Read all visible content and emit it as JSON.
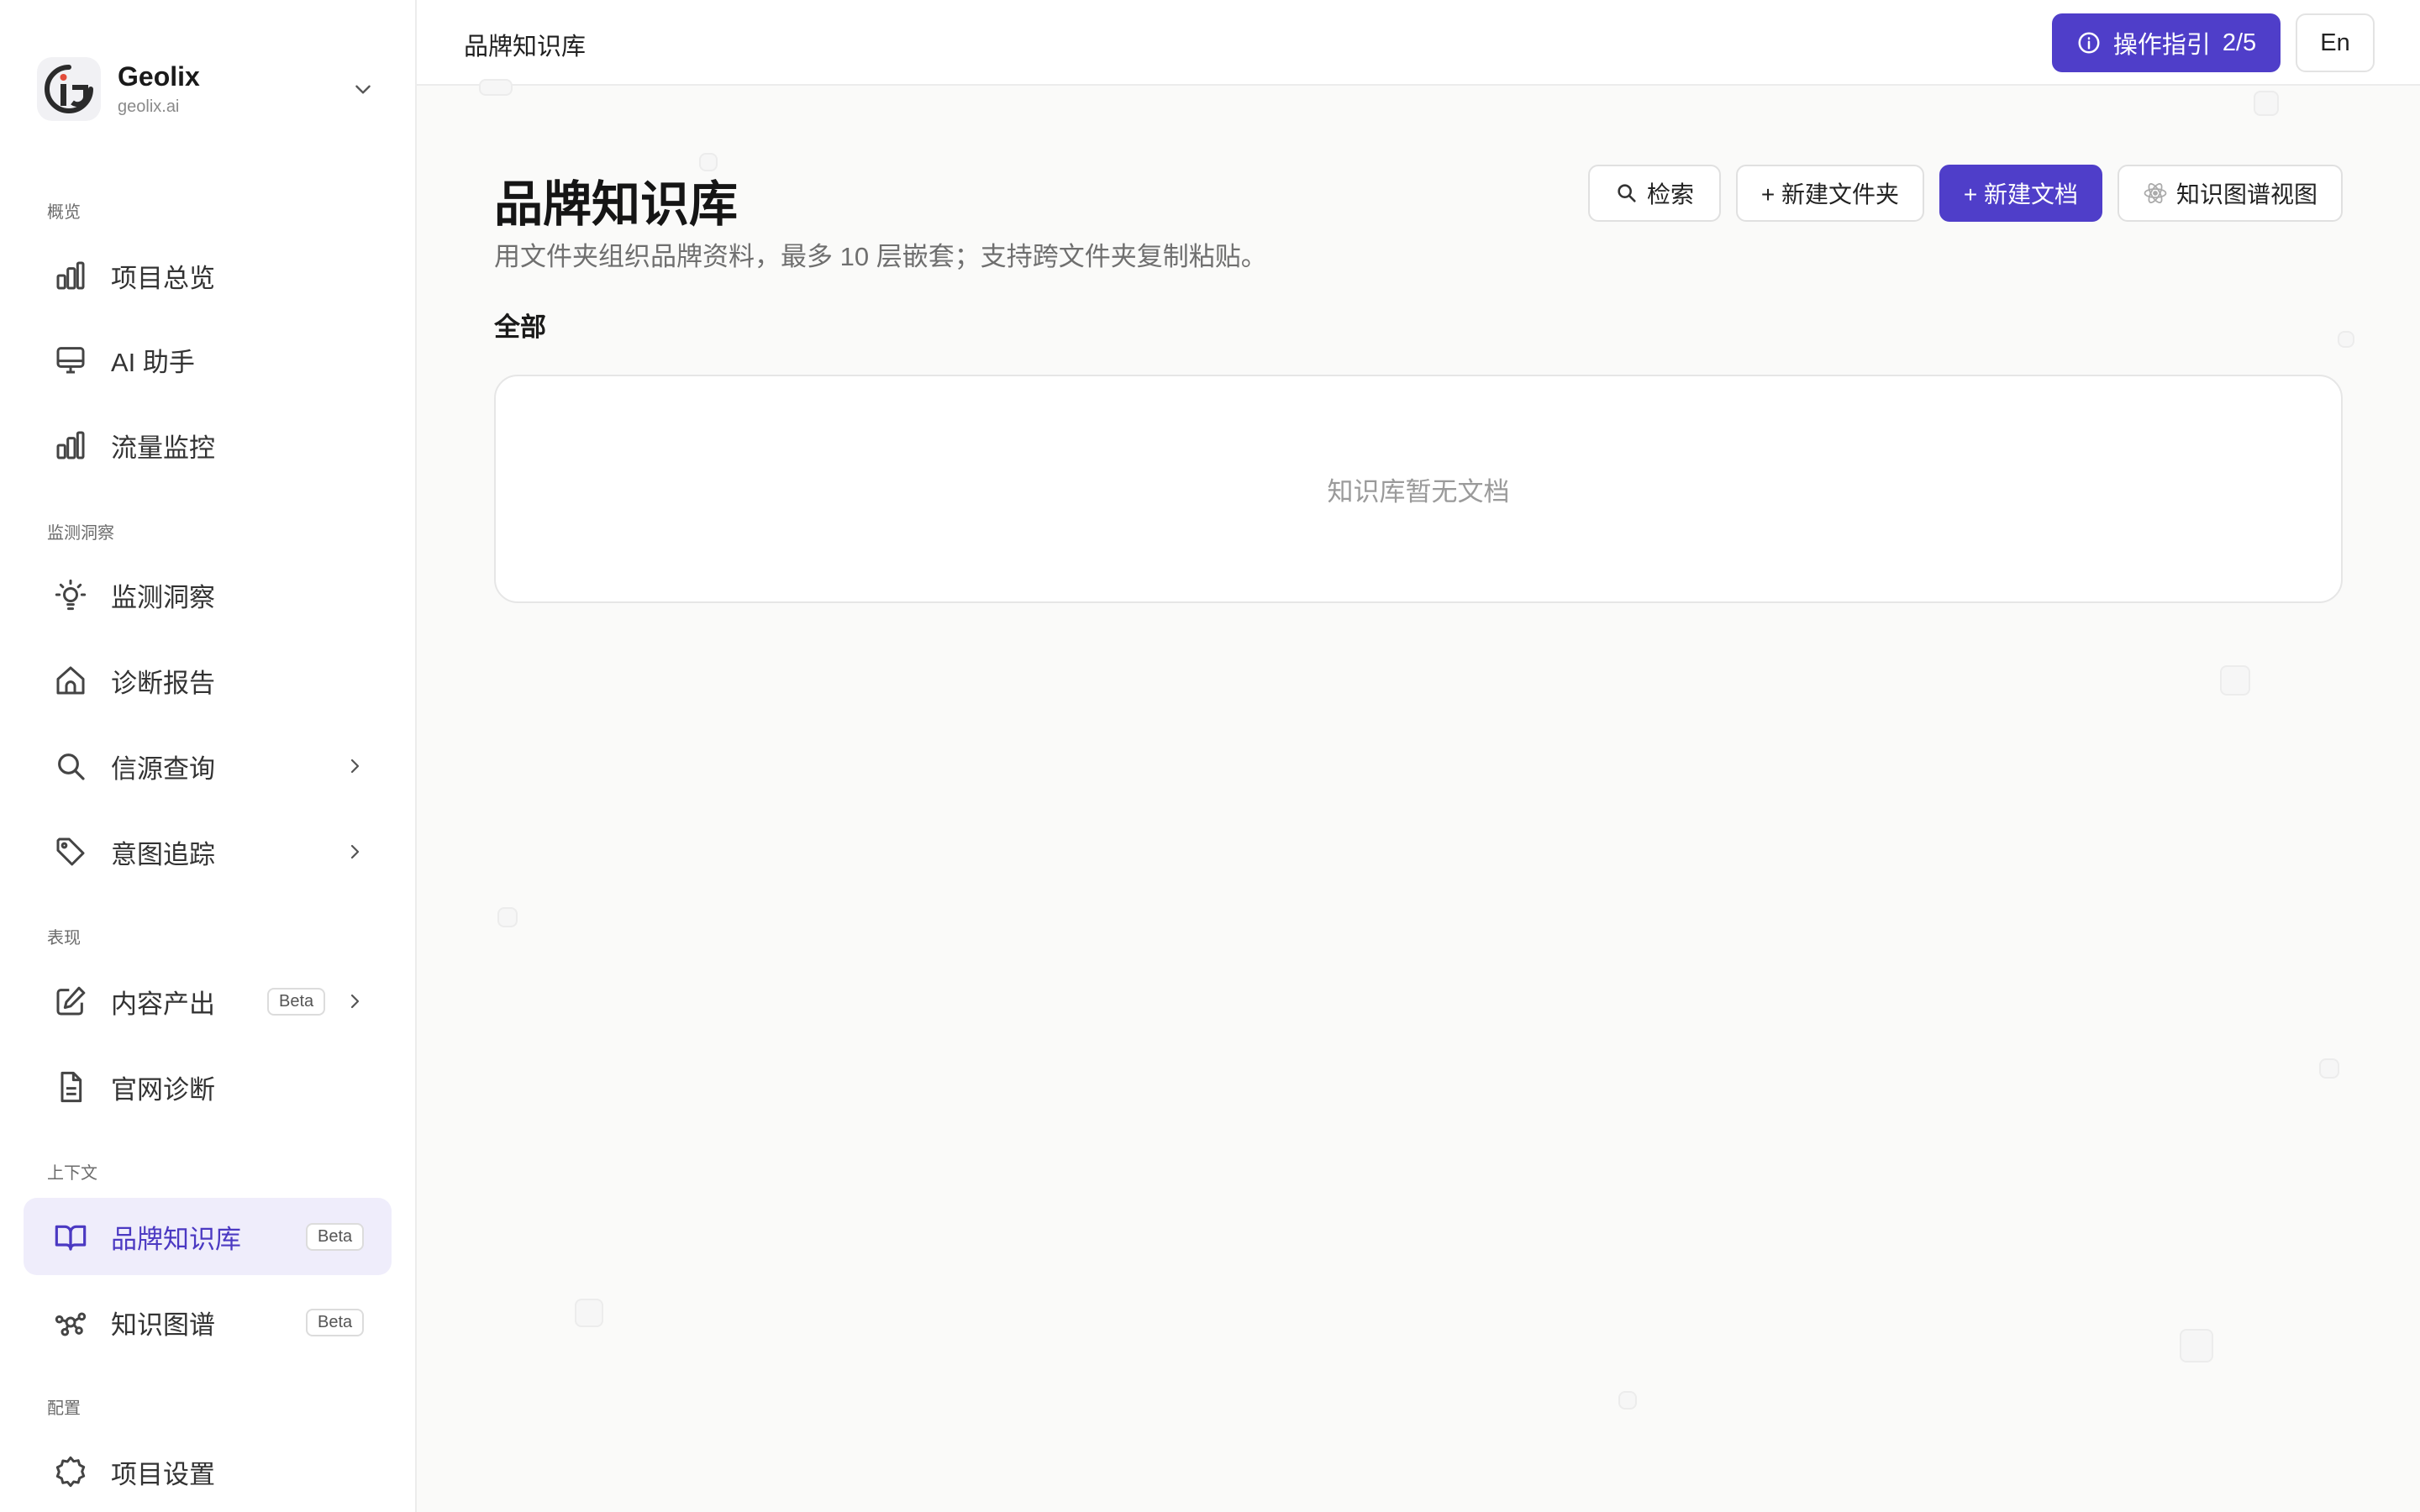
{
  "brand": {
    "name": "Geolix",
    "domain": "geolix.ai"
  },
  "sidebar": {
    "sections": {
      "overview": "概览",
      "monitor": "监测洞察",
      "performance": "表现",
      "context": "上下文",
      "config": "配置"
    },
    "items": [
      {
        "label": "项目总览",
        "icon": "bar-chart-icon"
      },
      {
        "label": "AI 助手",
        "icon": "monitor-icon"
      },
      {
        "label": "流量监控",
        "icon": "bar-chart-icon"
      },
      {
        "label": "监测洞察",
        "icon": "lightbulb-icon"
      },
      {
        "label": "诊断报告",
        "icon": "house-icon"
      },
      {
        "label": "信源查询",
        "icon": "search-icon"
      },
      {
        "label": "意图追踪",
        "icon": "tag-icon"
      },
      {
        "label": "内容产出",
        "icon": "edit-icon",
        "badge": "Beta"
      },
      {
        "label": "官网诊断",
        "icon": "file-icon"
      },
      {
        "label": "品牌知识库",
        "icon": "book-icon",
        "badge": "Beta",
        "active": true
      },
      {
        "label": "知识图谱",
        "icon": "graph-icon",
        "badge": "Beta"
      },
      {
        "label": "项目设置",
        "icon": "gear-icon"
      }
    ]
  },
  "topbar": {
    "title": "品牌知识库",
    "guide_label": "操作指引",
    "guide_step": "2/5",
    "lang": "En"
  },
  "main": {
    "title": "品牌知识库",
    "description": "用文件夹组织品牌资料，最多 10 层嵌套；支持跨文件夹复制粘贴。",
    "section": "全部",
    "empty_text": "知识库暂无文档",
    "buttons": {
      "search": "检索",
      "new_folder": "+ 新建文件夹",
      "new_doc": "+ 新建文档",
      "graph_view": "知识图谱视图"
    }
  },
  "colors": {
    "accent": "#4f3ec9",
    "active_bg": "#efedfb"
  }
}
